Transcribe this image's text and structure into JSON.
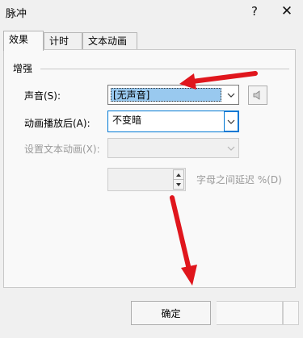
{
  "window": {
    "title": "脉冲",
    "help_glyph": "?",
    "close_glyph": "✕"
  },
  "tabs": [
    {
      "label": "效果",
      "active": true
    },
    {
      "label": "计时",
      "active": false
    },
    {
      "label": "文本动画",
      "active": false
    }
  ],
  "enhance_group": {
    "label": "增强",
    "sound": {
      "label": "声音(S):",
      "value": "[无声音]"
    },
    "after_animation": {
      "label": "动画播放后(A):",
      "value": "不变暗"
    },
    "animate_text": {
      "label": "设置文本动画(X):",
      "value": ""
    },
    "letter_delay": {
      "value": "",
      "label": "字母之间延迟 %(D)"
    }
  },
  "footer": {
    "ok_label": "确定"
  },
  "colors": {
    "annotation_arrow": "#e0161d",
    "selection": "#99c9ef",
    "focus": "#0078d4"
  }
}
